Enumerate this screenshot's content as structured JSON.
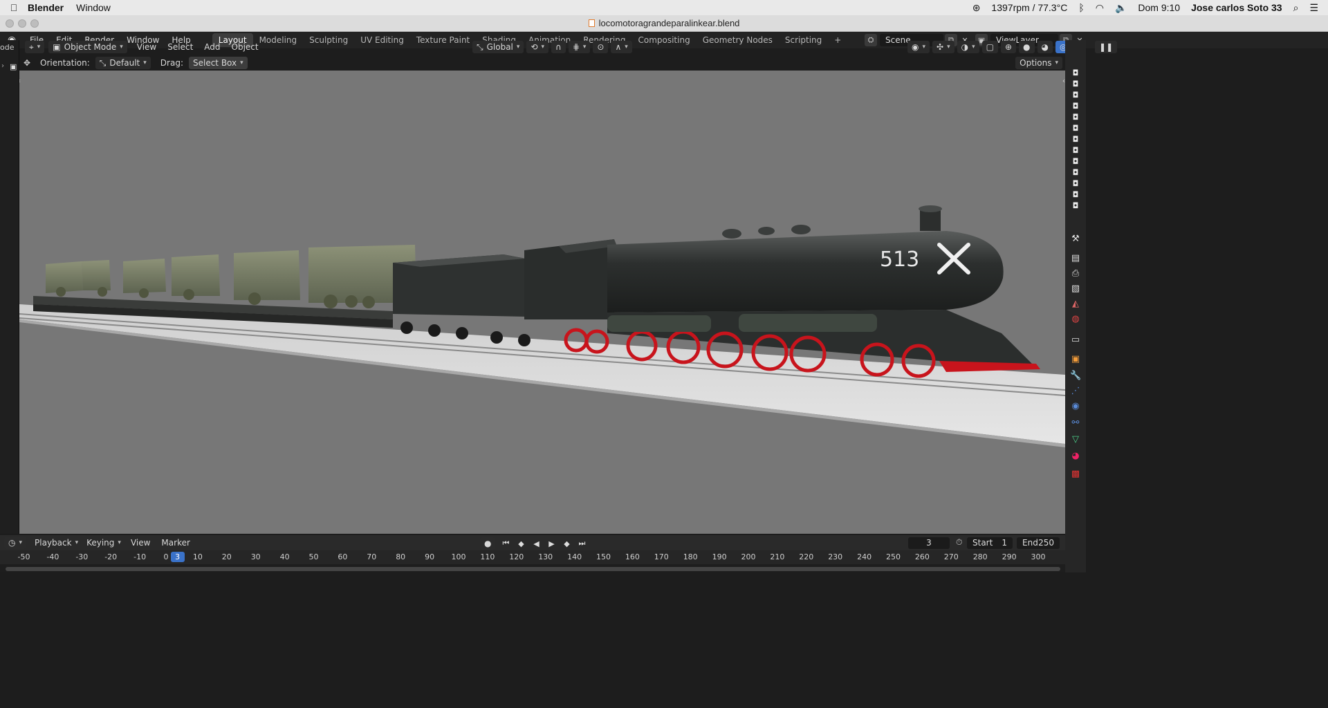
{
  "macos_menubar": {
    "app_name": "Blender",
    "menu_window": "Window",
    "status_rpm": "1397rpm / 77.3°C",
    "clock": "Dom 9:10",
    "user": "Jose carlos Soto 33"
  },
  "window": {
    "title": "locomotoragrandeparalinkear.blend"
  },
  "topbar": {
    "menus": [
      "File",
      "Edit",
      "Render",
      "Window",
      "Help"
    ],
    "workspaces": [
      "Layout",
      "Modeling",
      "Sculpting",
      "UV Editing",
      "Texture Paint",
      "Shading",
      "Animation",
      "Rendering",
      "Compositing",
      "Geometry Nodes",
      "Scripting"
    ],
    "active_workspace": "Layout",
    "add_workspace": "+",
    "scene_name": "Scene",
    "view_layer": "ViewLayer"
  },
  "viewport_header": {
    "left_cut_text": "ode",
    "mode": "Object Mode",
    "menus": [
      "View",
      "Select",
      "Add",
      "Object"
    ],
    "transform_orientation": "Global"
  },
  "tool_settings": {
    "orientation_label": "Orientation:",
    "orientation_value": "Default",
    "drag_label": "Drag:",
    "drag_value": "Select Box",
    "options": "Options"
  },
  "scene_label": {
    "locomotive_number": "513"
  },
  "timeline": {
    "menus": [
      "Playback",
      "Keying",
      "View",
      "Marker"
    ],
    "current_frame": "3",
    "start_label": "Start",
    "start_value": "1",
    "end_label": "End",
    "end_value": "250",
    "ruler_ticks": [
      "-50",
      "-40",
      "-30",
      "-20",
      "-10",
      "0",
      "10",
      "20",
      "30",
      "40",
      "50",
      "60",
      "70",
      "80",
      "90",
      "100",
      "110",
      "120",
      "130",
      "140",
      "150",
      "160",
      "170",
      "180",
      "190",
      "200",
      "210",
      "220",
      "230",
      "240",
      "250",
      "260",
      "270",
      "280",
      "290",
      "300"
    ]
  },
  "colors": {
    "viewport_bg": "#777777",
    "accent_blue": "#3a72c9",
    "wheel_red": "#c8141c"
  }
}
